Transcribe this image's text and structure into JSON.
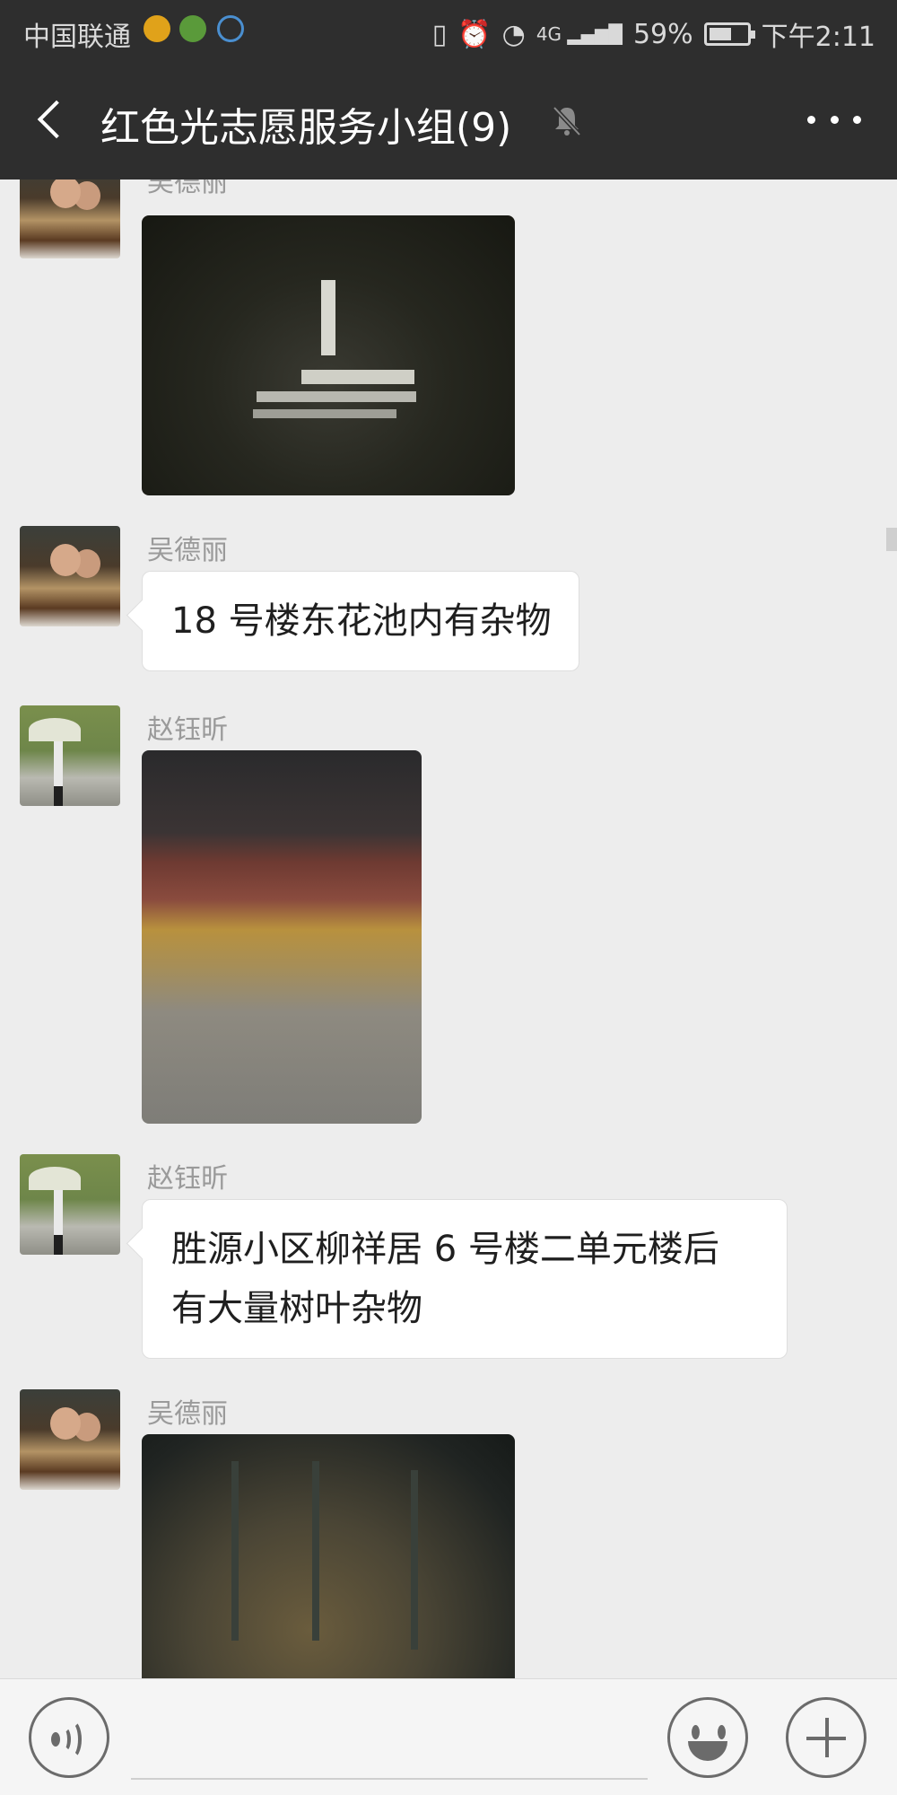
{
  "status_bar": {
    "carrier": "中国联通",
    "battery": "59%",
    "battery_level": 0.59,
    "time": "下午2:11",
    "network": "4G"
  },
  "header": {
    "title": "红色光志愿服务小组(9)",
    "muted": true
  },
  "messages": [
    {
      "type": "image",
      "sender": "吴德丽",
      "avatar": "couple-photo",
      "image_description": "夜间草地上的白色界桩与石板"
    },
    {
      "type": "text",
      "sender": "吴德丽",
      "avatar": "couple-photo",
      "text": "18 号楼东花池内有杂物"
    },
    {
      "type": "image",
      "sender": "赵钰昕",
      "avatar": "umbrella-photo",
      "image_description": "夜间花池边堆积的落叶"
    },
    {
      "type": "text",
      "sender": "赵钰昕",
      "avatar": "umbrella-photo",
      "lines": [
        "胜源小区柳祥居 6 号楼二单元楼后",
        "有大量树叶杂物"
      ]
    },
    {
      "type": "image",
      "sender": "吴德丽",
      "avatar": "couple-photo",
      "image_description": "夜间树下的枯枝杂物"
    }
  ],
  "input_bar": {
    "placeholder": ""
  },
  "colors": {
    "header_bg": "#2e2e2e",
    "chat_bg": "#ededed",
    "bubble_bg": "#ffffff",
    "sender_name": "#9a9a9a"
  }
}
